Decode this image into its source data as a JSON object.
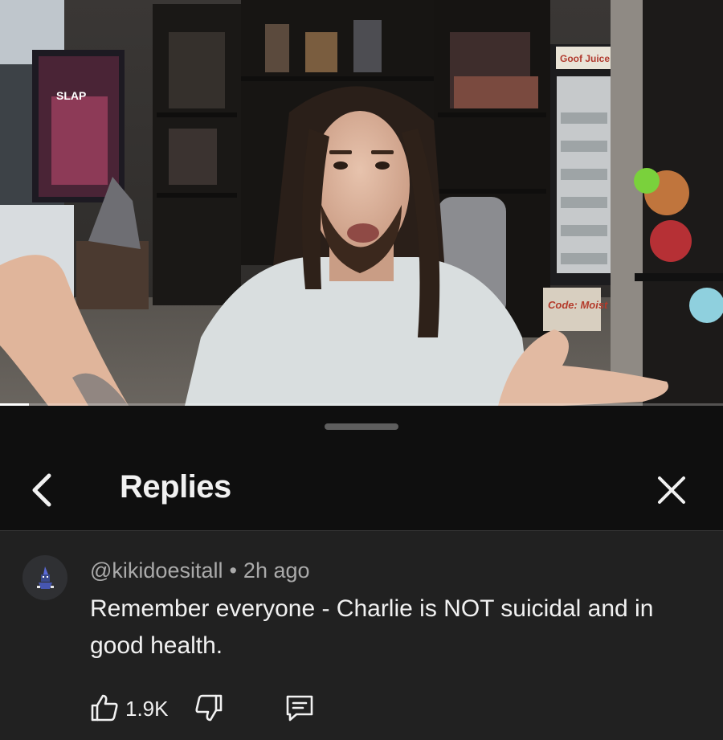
{
  "video": {
    "progress_fraction": 0.04,
    "sign_left": "SLAP",
    "sign_top_right": "Goof Juice",
    "sign_box": "Code: Moist"
  },
  "sheet": {
    "title": "Replies",
    "back_icon": "chevron-left-icon",
    "close_icon": "close-icon"
  },
  "comment": {
    "author": "@kikidoesitall",
    "separator": "•",
    "time": "2h ago",
    "text": "Remember everyone - Charlie is NOT suicidal and in good health.",
    "like_count": "1.9K",
    "icons": {
      "like": "thumbs-up-icon",
      "dislike": "thumbs-down-icon",
      "reply": "reply-comment-icon"
    }
  },
  "colors": {
    "sheet_bg": "#0f0f0f",
    "comment_bg": "#212121",
    "primary_text": "#f1f1f1",
    "secondary_text": "#aaaaaa"
  }
}
